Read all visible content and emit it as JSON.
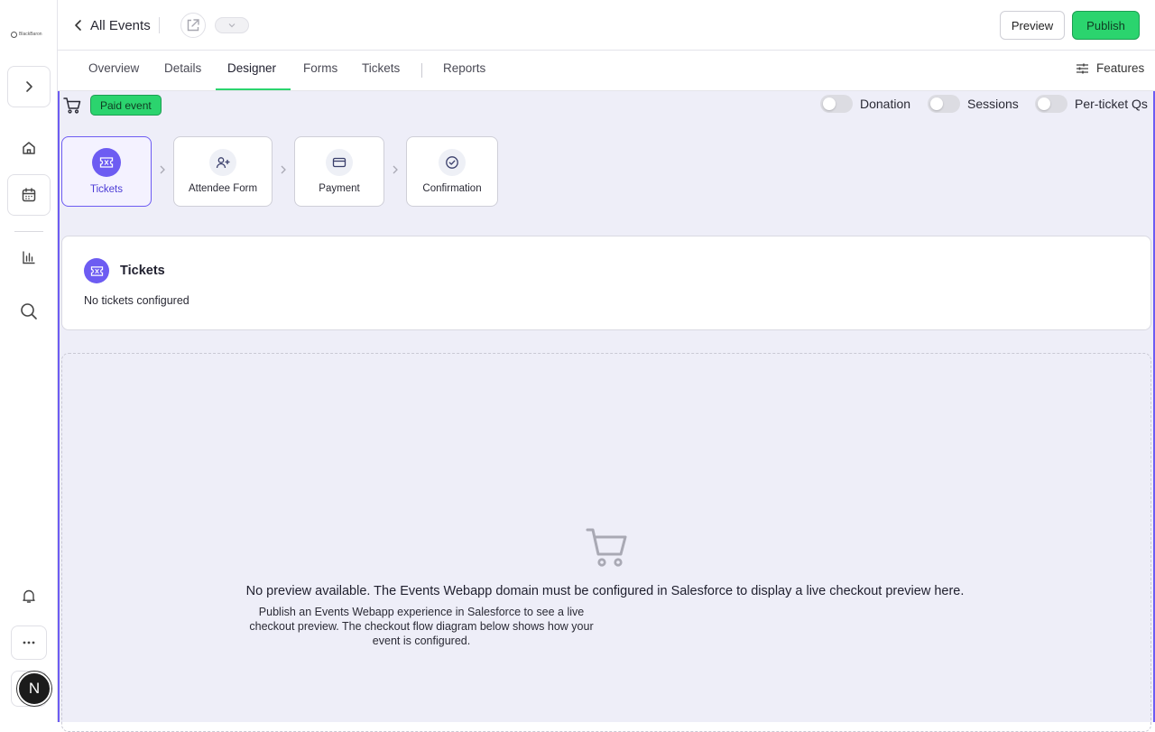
{
  "sidebar": {
    "logo_text": "BlackBaron",
    "items": [
      {
        "name": "expand",
        "icon": "chevron-right-icon"
      },
      {
        "name": "home",
        "icon": "home-icon"
      },
      {
        "name": "events",
        "icon": "calendar-icon"
      },
      {
        "name": "reports",
        "icon": "bar-chart-icon"
      },
      {
        "name": "search",
        "icon": "search-icon"
      },
      {
        "name": "notifications",
        "icon": "bell-icon"
      },
      {
        "name": "more",
        "icon": "more-horizontal-icon"
      }
    ],
    "avatar_initial": "N"
  },
  "header": {
    "back_label": "All Events",
    "preview_label": "Preview",
    "publish_label": "Publish",
    "publish_color": "#2bd46e"
  },
  "tabs": [
    {
      "label": "Overview"
    },
    {
      "label": "Details"
    },
    {
      "label": "Designer",
      "active": true
    },
    {
      "label": "Forms"
    },
    {
      "label": "Tickets"
    },
    {
      "label": "Reports"
    }
  ],
  "features_label": "Features",
  "designer": {
    "badge": "Paid event",
    "toggles": [
      {
        "label": "Donation",
        "on": false
      },
      {
        "label": "Sessions",
        "on": false
      },
      {
        "label": "Per-ticket Qs",
        "on": false
      }
    ],
    "steps": [
      {
        "label": "Tickets",
        "icon": "ticket-icon",
        "active": true
      },
      {
        "label": "Attendee Form",
        "icon": "user-plus-icon"
      },
      {
        "label": "Payment",
        "icon": "credit-card-icon"
      },
      {
        "label": "Confirmation",
        "icon": "check-circle-icon"
      }
    ],
    "tickets_card": {
      "title": "Tickets",
      "empty_text": "No tickets configured"
    },
    "preview": {
      "title": "No preview available. The Events Webapp domain must be configured in Salesforce to display a live checkout preview here.",
      "note": "Publish an Events Webapp experience in Salesforce to see a live checkout preview. The checkout flow diagram below shows how your event is configured."
    },
    "accent_color": "#6d5cf2"
  }
}
